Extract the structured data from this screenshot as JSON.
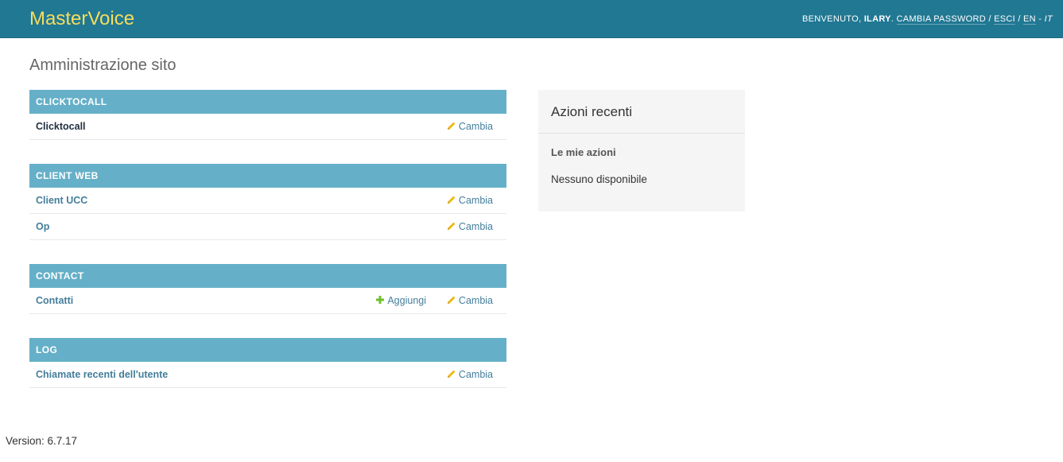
{
  "header": {
    "brand": "MasterVoice",
    "welcome": "BENVENUTO,",
    "username": "ILARY",
    "change_password": "CAMBIA PASSWORD",
    "sep1": "/",
    "logout": "ESCI",
    "sep2": "/",
    "lang_en": "EN",
    "dash": "-",
    "lang_it": "IT"
  },
  "page": {
    "title": "Amministrazione sito"
  },
  "modules": [
    {
      "caption": "CLICKTOCALL",
      "models": [
        {
          "name": "Clicktocall",
          "change": "Cambia"
        }
      ]
    },
    {
      "caption": "CLIENT WEB",
      "models": [
        {
          "name": "Client UCC",
          "change": "Cambia"
        },
        {
          "name": "Op",
          "change": "Cambia"
        }
      ]
    },
    {
      "caption": "CONTACT",
      "models": [
        {
          "name": "Contatti",
          "add": "Aggiungi",
          "change": "Cambia"
        }
      ]
    },
    {
      "caption": "LOG",
      "models": [
        {
          "name": "Chiamate recenti dell'utente",
          "change": "Cambia"
        }
      ]
    }
  ],
  "recent_actions": {
    "title": "Azioni recenti",
    "subtitle": "Le mie azioni",
    "empty": "Nessuno disponibile"
  },
  "footer": {
    "version": "Version: 6.7.17"
  },
  "icons": {
    "change": "pencil-icon",
    "add": "plus-icon"
  },
  "colors": {
    "header_bg": "#217893",
    "brand": "#f5dd5d",
    "module_caption_bg": "#65b0c8",
    "link": "#447e9b",
    "pencil": "#efb80b",
    "plus": "#70bf2b"
  }
}
